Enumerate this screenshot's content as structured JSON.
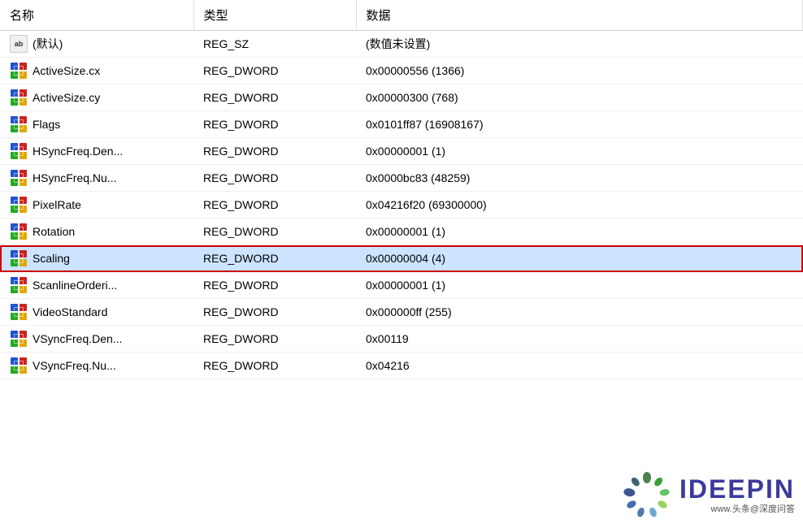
{
  "table": {
    "headers": [
      "名称",
      "类型",
      "数据"
    ],
    "rows": [
      {
        "icon": "ab",
        "name": "(默认)",
        "type": "REG_SZ",
        "data": "(数值未设置)",
        "selected": false
      },
      {
        "icon": "dword",
        "name": "ActiveSize.cx",
        "type": "REG_DWORD",
        "data": "0x00000556 (1366)",
        "selected": false
      },
      {
        "icon": "dword",
        "name": "ActiveSize.cy",
        "type": "REG_DWORD",
        "data": "0x00000300 (768)",
        "selected": false
      },
      {
        "icon": "dword",
        "name": "Flags",
        "type": "REG_DWORD",
        "data": "0x0101ff87 (16908167)",
        "selected": false
      },
      {
        "icon": "dword",
        "name": "HSyncFreq.Den...",
        "type": "REG_DWORD",
        "data": "0x00000001 (1)",
        "selected": false
      },
      {
        "icon": "dword",
        "name": "HSyncFreq.Nu...",
        "type": "REG_DWORD",
        "data": "0x0000bc83 (48259)",
        "selected": false
      },
      {
        "icon": "dword",
        "name": "PixelRate",
        "type": "REG_DWORD",
        "data": "0x04216f20 (69300000)",
        "selected": false
      },
      {
        "icon": "dword",
        "name": "Rotation",
        "type": "REG_DWORD",
        "data": "0x00000001 (1)",
        "selected": false
      },
      {
        "icon": "dword",
        "name": "Scaling",
        "type": "REG_DWORD",
        "data": "0x00000004 (4)",
        "selected": true
      },
      {
        "icon": "dword",
        "name": "ScanlineOrderi...",
        "type": "REG_DWORD",
        "data": "0x00000001 (1)",
        "selected": false
      },
      {
        "icon": "dword",
        "name": "VideoStandard",
        "type": "REG_DWORD",
        "data": "0x000000ff (255)",
        "selected": false
      },
      {
        "icon": "dword",
        "name": "VSyncFreq.Den...",
        "type": "REG_DWORD",
        "data": "0x00119",
        "selected": false
      },
      {
        "icon": "dword",
        "name": "VSyncFreq.Nu...",
        "type": "REG_DWORD",
        "data": "0x04216",
        "selected": false
      }
    ]
  },
  "watermark": {
    "logo_text": "IDEEPIN",
    "sub_text": "www.头条@深度问答"
  }
}
